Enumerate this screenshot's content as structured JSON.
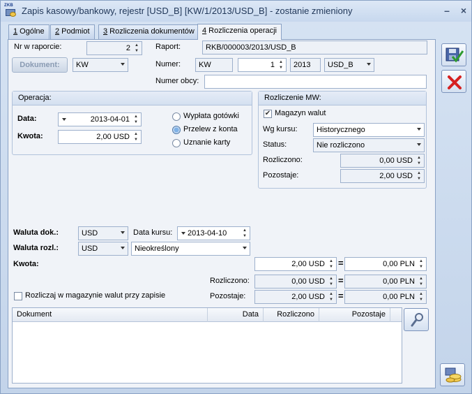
{
  "window": {
    "title": "Zapis kasowy/bankowy, rejestr [USD_B] [KW/1/2013/USD_B] - zostanie zmieniony",
    "icon_text": "ZKB"
  },
  "tabs": [
    {
      "key": "1",
      "label": " Ogólne"
    },
    {
      "key": "2",
      "label": " Podmiot"
    },
    {
      "key": "3",
      "label": " Rozliczenia dokumentów"
    },
    {
      "key": "4",
      "label": " Rozliczenia operacji"
    }
  ],
  "header": {
    "nr_w_raporcie_label": "Nr w raporcie:",
    "nr_w_raporcie_value": "2",
    "raport_label": "Raport:",
    "raport_value": "RKB/000003/2013/USD_B",
    "dokument_button": "Dokument:",
    "dokument_type": "KW",
    "numer_label": "Numer:",
    "numer_prefix": "KW",
    "numer_value": "1",
    "numer_year": "2013",
    "numer_register": "USD_B",
    "numer_obcy_label": "Numer obcy:",
    "numer_obcy_value": ""
  },
  "operacja": {
    "title": "Operacja:",
    "data_label": "Data:",
    "data_value": "2013-04-01",
    "kwota_label": "Kwota:",
    "kwota_value": "2,00 USD",
    "options": [
      "Wypłata gotówki",
      "Przelew z konta",
      "Uznanie karty"
    ],
    "selected_option": "Przelew z konta"
  },
  "rozliczenie_mw": {
    "title": "Rozliczenie MW:",
    "magazyn_walut_label": "Magazyn walut",
    "magazyn_walut_checked": true,
    "wg_kursu_label": "Wg kursu:",
    "wg_kursu_value": "Historycznego",
    "status_label": "Status:",
    "status_value": "Nie rozliczono",
    "rozliczono_label": "Rozliczono:",
    "rozliczono_value": "0,00 USD",
    "pozostaje_label": "Pozostaje:",
    "pozostaje_value": "2,00 USD"
  },
  "waluta": {
    "waluta_dok_label": "Waluta dok.:",
    "waluta_dok_value": "USD",
    "data_kursu_label": "Data kursu:",
    "data_kursu_value": "2013-04-10",
    "waluta_rozl_label": "Waluta rozl.:",
    "waluta_rozl_value": "USD",
    "kurs_type_value": "Nieokreślony",
    "kwota_label": "Kwota:",
    "kwota_value": "2,00 USD",
    "kwota_pln": "0,00 PLN",
    "rozliczono_label": "Rozliczono:",
    "rozliczono_value": "0,00 USD",
    "rozliczono_pln": "0,00 PLN",
    "pozostaje_label": "Pozostaje:",
    "pozostaje_value": "2,00 USD",
    "pozostaje_pln": "0,00 PLN",
    "eq": "=",
    "rozliczaj_label": "Rozliczaj w magazynie walut przy zapisie",
    "rozliczaj_checked": false
  },
  "table": {
    "columns": [
      "Dokument",
      "Data",
      "Rozliczono",
      "Pozostaje"
    ],
    "rows": []
  },
  "icons": {
    "save": "save-check-icon",
    "cancel": "cancel-x-icon",
    "search": "magnifier-icon",
    "coins": "coins-icon"
  },
  "colors": {
    "accent_red": "#d62020",
    "accent_green": "#2e9b2e",
    "frame": "#8aa2c5"
  }
}
